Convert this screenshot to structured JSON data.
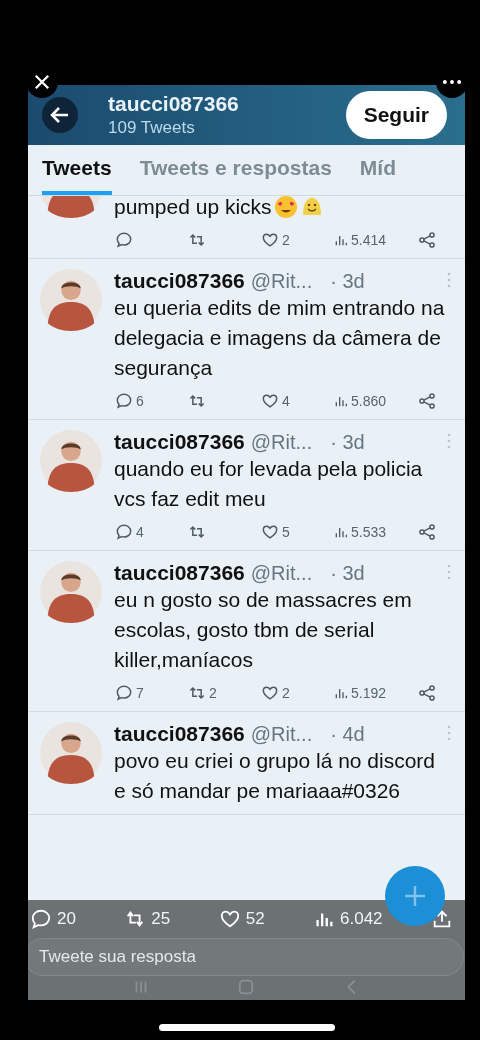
{
  "profile": {
    "name": "taucci087366",
    "tweet_count": "109 Tweets",
    "follow_button": "Seguir"
  },
  "tabs": [
    {
      "label": "Tweets",
      "selected": true
    },
    {
      "label": "Tweets e respostas",
      "selected": false
    },
    {
      "label": "Míd",
      "selected": false
    }
  ],
  "tweets": [
    {
      "kind": "partial",
      "text": "pumped up kicks",
      "stats": {
        "likes": "2",
        "views": "5.414"
      }
    },
    {
      "kind": "full",
      "name": "taucci087366",
      "handle": "@Rit...",
      "time": "· 3d",
      "text": "eu queria edits de mim entrando na delegacia e imagens da câmera de segurança",
      "stats": {
        "replies": "6",
        "likes": "4",
        "views": "5.860"
      }
    },
    {
      "kind": "full",
      "name": "taucci087366",
      "handle": "@Rit...",
      "time": "· 3d",
      "text": "quando eu for levada pela policia vcs faz edit meu",
      "stats": {
        "replies": "4",
        "likes": "5",
        "views": "5.533"
      }
    },
    {
      "kind": "full",
      "name": "taucci087366",
      "handle": "@Rit...",
      "time": "· 3d",
      "text": "eu n gosto so de massacres em escolas, gosto tbm de serial killer,maníacos",
      "stats": {
        "replies": "7",
        "retweets": "2",
        "likes": "2",
        "views": "5.192"
      }
    },
    {
      "kind": "full",
      "name": "taucci087366",
      "handle": "@Rit...",
      "time": "· 4d",
      "text": "povo eu criei o grupo lá no discord e só mandar pe mariaaa#0326"
    }
  ],
  "video_stats": {
    "comments": "20",
    "reposts": "25",
    "likes": "52",
    "views": "6.042"
  },
  "reply_field": {
    "placeholder": "Tweete sua resposta"
  }
}
